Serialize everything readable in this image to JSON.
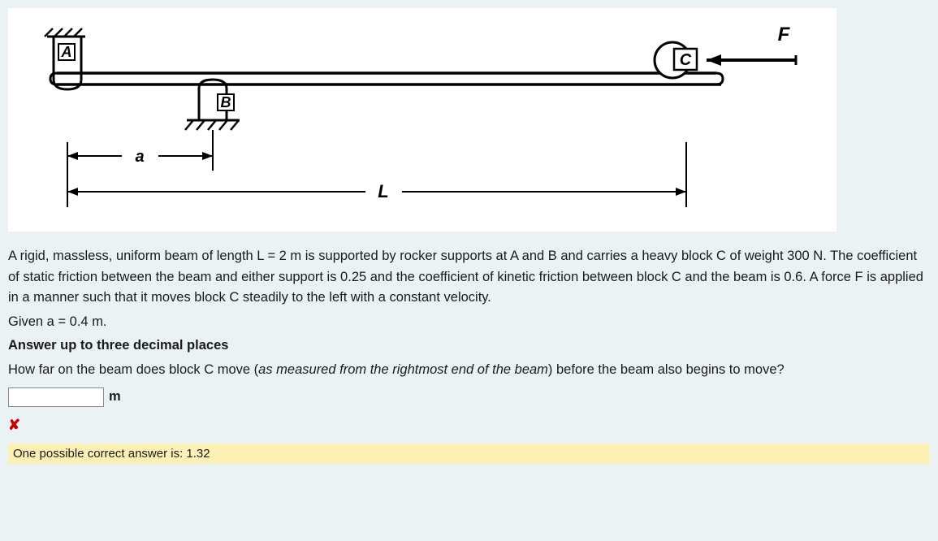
{
  "figure": {
    "label_A": "A",
    "label_B": "B",
    "label_C": "C",
    "label_F": "F",
    "label_a": "a",
    "label_L": "L"
  },
  "problem": {
    "statement": "A rigid, massless, uniform beam of length L = 2 m is supported by rocker supports at A and B and carries a heavy block C of weight 300 N. The coefficient of static friction between the beam and either support is 0.25 and the coefficient of kinetic friction between block C and the beam is 0.6. A force F is applied in a manner such that it moves block C steadily to the left with a constant velocity.",
    "given": "Given a = 0.4 m.",
    "instruction": "Answer up to three decimal places",
    "question_prefix": "How far on the beam does block C move (",
    "question_italic": "as measured from the rightmost end of the beam",
    "question_suffix": ") before the beam also begins to move?",
    "unit": "m"
  },
  "feedback": {
    "icon": "✘",
    "solution_prefix": "One possible correct answer is: ",
    "solution_value": "1.32"
  }
}
